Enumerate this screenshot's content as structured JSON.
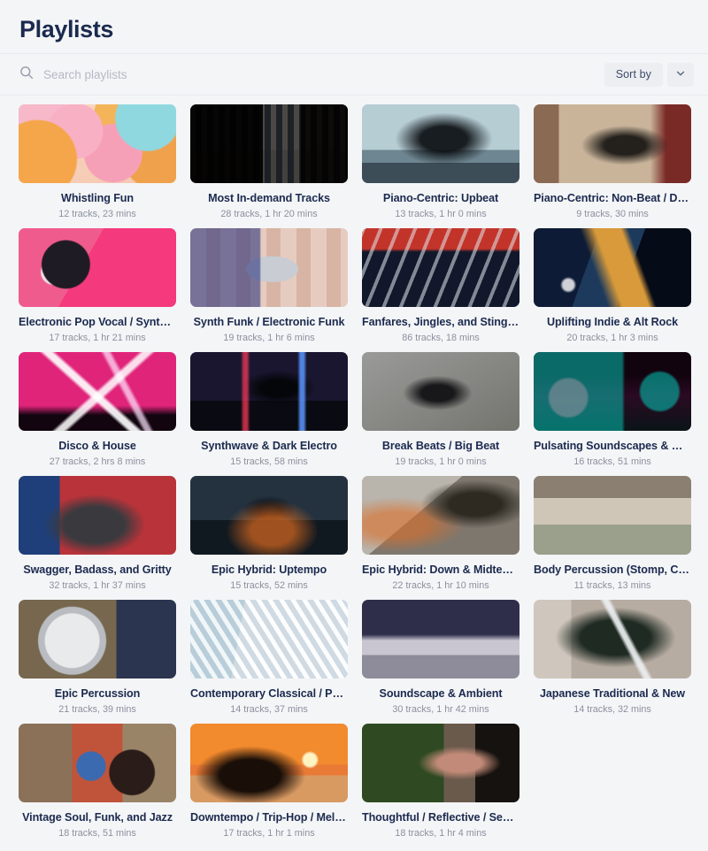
{
  "header": {
    "title": "Playlists"
  },
  "search": {
    "placeholder": "Search playlists",
    "value": "",
    "icon": "search-icon"
  },
  "sort": {
    "label": "Sort by",
    "caret_icon": "chevron-down-icon"
  },
  "colors": {
    "page_background": "#f4f5f7",
    "title_text": "#1b2a4e",
    "meta_text": "#8a909e",
    "divider": "#e8eaee",
    "button_background": "#eceef1"
  },
  "playlists": [
    {
      "title": "Whistling Fun",
      "meta": "12 tracks, 23 mins",
      "art": "balloons"
    },
    {
      "title": "Most In-demand Tracks",
      "meta": "28 tracks, 1 hr 20 mins",
      "art": "streaming-ui"
    },
    {
      "title": "Piano-Centric: Upbeat",
      "meta": "13 tracks, 1 hr 0 mins",
      "art": "grand-piano-window"
    },
    {
      "title": "Piano-Centric: Non-Beat / Downbeat",
      "meta": "9 tracks, 30 mins",
      "art": "piano-old-room"
    },
    {
      "title": "Electronic Pop Vocal / Synthpop",
      "meta": "17 tracks, 1 hr 21 mins",
      "art": "pink-headphones"
    },
    {
      "title": "Synth Funk / Electronic Funk",
      "meta": "19 tracks, 1 hr 6 mins",
      "art": "boombox-dancers"
    },
    {
      "title": "Fanfares, Jingles, and Stingers",
      "meta": "86 tracks, 18 mins",
      "art": "trumpet-band"
    },
    {
      "title": "Uplifting Indie & Alt Rock",
      "meta": "20 tracks, 1 hr 3 mins",
      "art": "guitarist-stage"
    },
    {
      "title": "Disco & House",
      "meta": "27 tracks, 2 hrs 8 mins",
      "art": "club-lasers"
    },
    {
      "title": "Synthwave & Dark Electro",
      "meta": "15 tracks, 58 mins",
      "art": "neon-alley"
    },
    {
      "title": "Break Beats / Big Beat",
      "meta": "19 tracks, 1 hr 0 mins",
      "art": "bboy-jump"
    },
    {
      "title": "Pulsating Soundscapes & Grooves",
      "meta": "16 tracks, 51 mins",
      "art": "neon-city-street"
    },
    {
      "title": "Swagger, Badass, and Gritty",
      "meta": "32 tracks, 1 hr 37 mins",
      "art": "gym-flag"
    },
    {
      "title": "Epic Hybrid: Uptempo",
      "meta": "15 tracks, 52 mins",
      "art": "burning-street"
    },
    {
      "title": "Epic Hybrid: Down & Midtempo",
      "meta": "22 tracks, 1 hr 10 mins",
      "art": "warrior-eagle"
    },
    {
      "title": "Body Percussion (Stomp, Clap, and Snap)",
      "meta": "11 tracks, 13 mins",
      "art": "dancers-arms-up"
    },
    {
      "title": "Epic Percussion",
      "meta": "21 tracks, 39 mins",
      "art": "bass-drum"
    },
    {
      "title": "Contemporary Classical / Postmodern",
      "meta": "14 tracks, 37 mins",
      "art": "modern-architecture"
    },
    {
      "title": "Soundscape & Ambient",
      "meta": "30 tracks, 1 hr 42 mins",
      "art": "snow-mountains-stars"
    },
    {
      "title": "Japanese Traditional & New",
      "meta": "14 tracks, 32 mins",
      "art": "katana-samurai"
    },
    {
      "title": "Vintage Soul, Funk, and Jazz",
      "meta": "18 tracks, 51 mins",
      "art": "seventies-group"
    },
    {
      "title": "Downtempo / Trip-Hop / Mellow Hip-Hop",
      "meta": "17 tracks, 1 hr 1 mins",
      "art": "sunset-silhouette"
    },
    {
      "title": "Thoughtful / Reflective / Sentimental",
      "meta": "18 tracks, 1 hr 4 mins",
      "art": "woman-forest-window"
    }
  ]
}
